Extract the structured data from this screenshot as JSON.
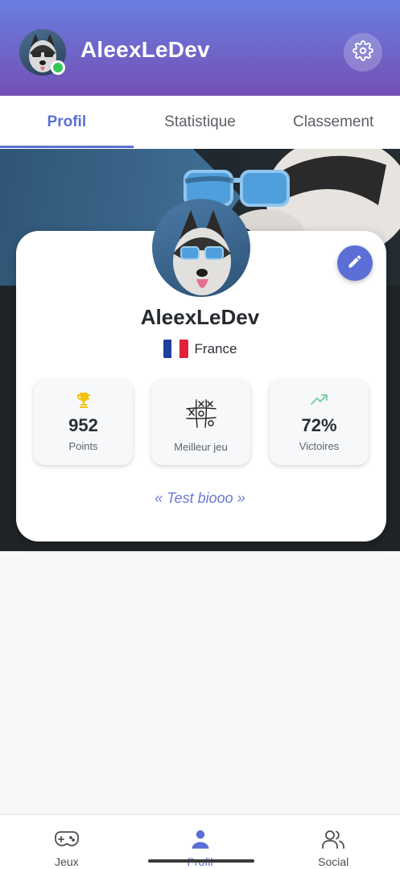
{
  "header": {
    "username": "AleexLeDev",
    "accent_start": "#6a7ee0",
    "accent_end": "#7350b5",
    "status": "online",
    "settings_icon": "gear-icon"
  },
  "tabs": [
    {
      "label": "Profil",
      "active": true
    },
    {
      "label": "Statistique",
      "active": false
    },
    {
      "label": "Classement",
      "active": false
    }
  ],
  "profile": {
    "name": "AleexLeDev",
    "country": "France",
    "flag_icon": "france-flag-icon",
    "edit_icon": "pencil-icon",
    "bio": "« Test biooo »"
  },
  "stats": [
    {
      "icon": "trophy-icon",
      "value": "952",
      "label": "Points"
    },
    {
      "icon": "tic-tac-toe-icon",
      "value": "",
      "label": "Meilleur jeu"
    },
    {
      "icon": "trending-up-icon",
      "value": "72%",
      "label": "Victoires"
    }
  ],
  "bottom_nav": [
    {
      "icon": "gamepad-icon",
      "label": "Jeux",
      "active": false
    },
    {
      "icon": "user-icon",
      "label": "Profil",
      "active": true
    },
    {
      "icon": "users-icon",
      "label": "Social",
      "active": false
    }
  ],
  "colors": {
    "primary": "#5b6fd6",
    "online": "#34c759",
    "trophy": "#f4c20d",
    "trend": "#7fd3a8"
  }
}
